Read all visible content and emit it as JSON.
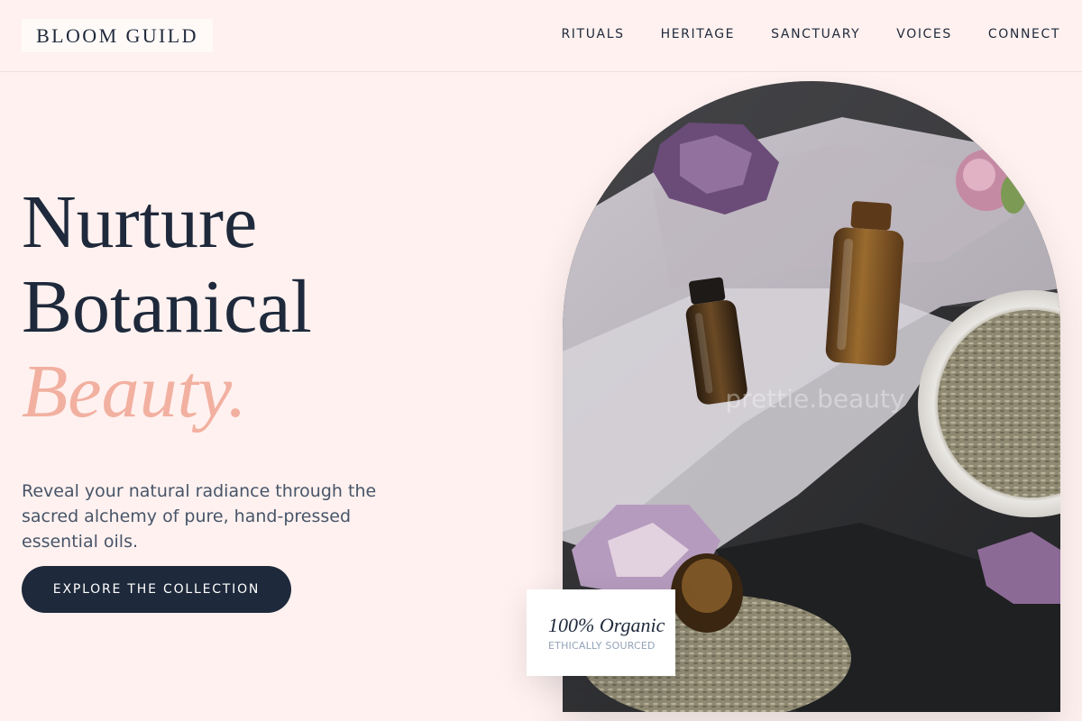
{
  "header": {
    "logo": "BLOOM GUILD",
    "nav": [
      "RITUALS",
      "HERITAGE",
      "SANCTUARY",
      "VOICES",
      "CONNECT"
    ]
  },
  "hero": {
    "title_line1": "Nurture",
    "title_line2": "Botanical",
    "title_accent": "Beauty.",
    "lede": "Reveal your natural radiance through the sacred alchemy of pure, hand-pressed essential oils.",
    "cta_label": "EXPLORE THE COLLECTION"
  },
  "image": {
    "watermark": "prettie.beauty"
  },
  "badge": {
    "title": "100% Organic",
    "subtitle": "ETHICALLY SOURCED"
  },
  "colors": {
    "background": "#fff1ef",
    "ink": "#1e293b",
    "accent": "#f2b0a0",
    "muted": "#475569"
  }
}
